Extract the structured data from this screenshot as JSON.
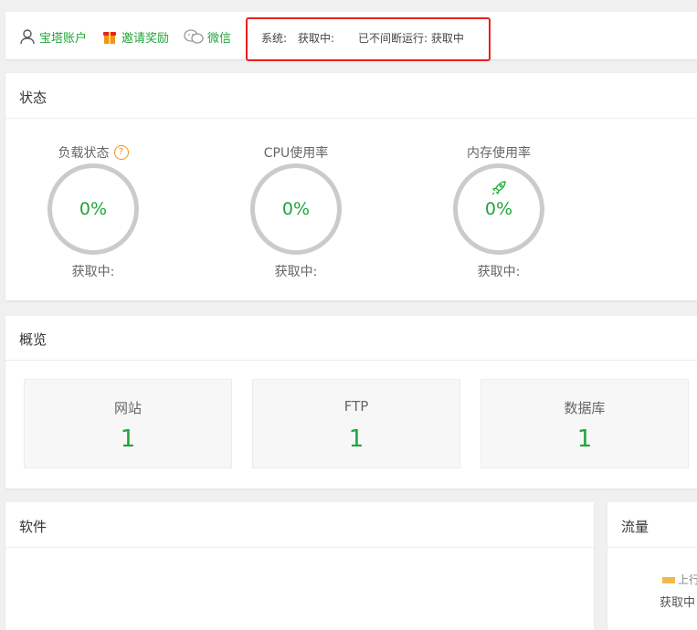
{
  "topbar": {
    "account_label": "宝塔账户",
    "invite_label": "邀请奖励",
    "wechat_label": "微信",
    "system_label": "系统:",
    "system_value": "获取中:",
    "uptime_label": "已不间断运行: 获取中"
  },
  "status": {
    "title": "状态",
    "gauges": [
      {
        "label": "负载状态",
        "value": "0%",
        "sub": "获取中:"
      },
      {
        "label": "CPU使用率",
        "value": "0%",
        "sub": "获取中:"
      },
      {
        "label": "内存使用率",
        "value": "0%",
        "sub": "获取中:"
      }
    ]
  },
  "overview": {
    "title": "概览",
    "cards": [
      {
        "label": "网站",
        "value": "1"
      },
      {
        "label": "FTP",
        "value": "1"
      },
      {
        "label": "数据库",
        "value": "1"
      }
    ]
  },
  "software": {
    "title": "软件"
  },
  "traffic": {
    "title": "流量",
    "legend_up": "上行",
    "status": "获取中"
  },
  "colors": {
    "accent": "#20a53a",
    "ring": "#cbcbcb",
    "highlight_border": "#e8221c",
    "help": "#f0941d"
  },
  "icons": [
    "user-icon",
    "gift-icon",
    "wechat-icon",
    "help-icon",
    "rocket-icon"
  ]
}
